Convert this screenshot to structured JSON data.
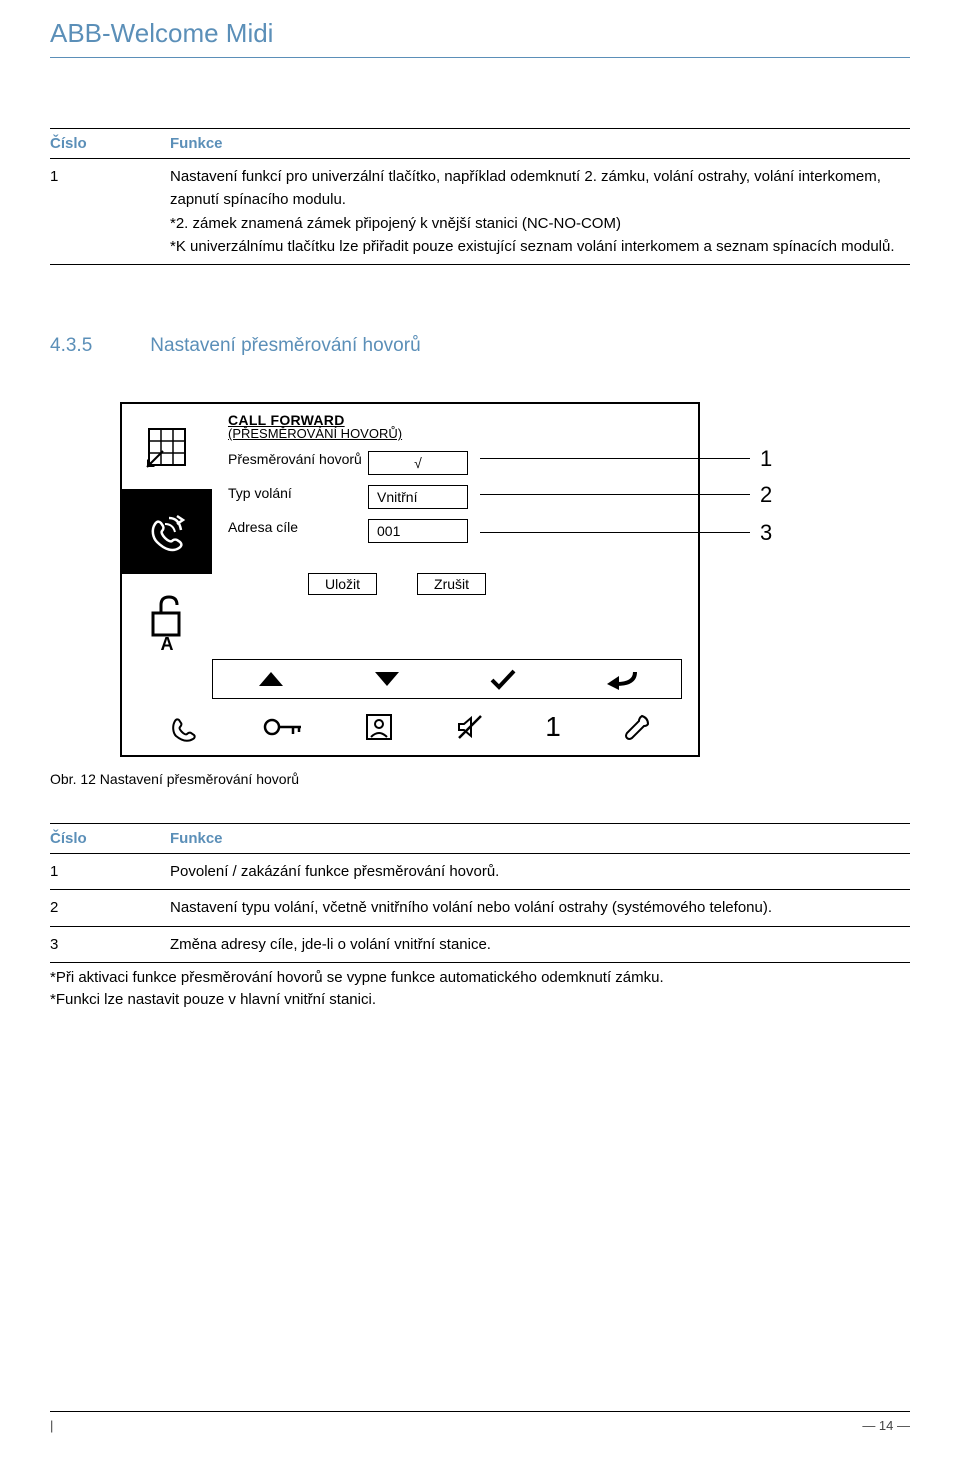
{
  "header": {
    "title": "ABB-Welcome Midi"
  },
  "table1": {
    "head_num": "Číslo",
    "head_func": "Funkce",
    "rows": [
      {
        "n": "1",
        "t": "Nastavení funkcí pro univerzální tlačítko, například odemknutí 2. zámku, volání ostrahy, volání interkomem, zapnutí spínacího modulu.\n*2. zámek znamená zámek připojený k vnější stanici (NC-NO-COM)\n*K univerzálnímu tlačítku lze přiřadit pouze existující seznam volání interkomem a seznam spínacích modulů."
      }
    ]
  },
  "section": {
    "num": "4.3.5",
    "title": "Nastavení přesměrování hovorů"
  },
  "screen": {
    "title": "CALL FORWARD",
    "subtitle": "(PŘESMĚROVÁNÍ HOVORŮ)",
    "row1_label": "Přesměrování hovorů",
    "row1_value": "√",
    "row2_label": "Typ volání",
    "row2_value": "Vnitřní",
    "row3_label": "Adresa cíle",
    "row3_value": "001",
    "save": "Uložit",
    "cancel": "Zrušit",
    "sidebar_A": "A"
  },
  "callouts": {
    "c1": "1",
    "c2": "2",
    "c3": "3"
  },
  "iconbar_num": "1",
  "figcap": "Obr. 12   Nastavení přesměrování hovorů",
  "table2": {
    "head_num": "Číslo",
    "head_func": "Funkce",
    "rows": [
      {
        "n": "1",
        "t": "Povolení / zakázání funkce přesměrování hovorů."
      },
      {
        "n": "2",
        "t": "Nastavení typu volání, včetně vnitřního volání nebo volání ostrahy (systémového telefonu)."
      },
      {
        "n": "3",
        "t": "Změna adresy cíle, jde-li o volání vnitřní stanice."
      }
    ]
  },
  "footnote1": "*Při aktivaci funkce přesměrování hovorů se vypne funkce automatického odemknutí zámku.",
  "footnote2": "*Funkci lze nastavit pouze v hlavní vnitřní stanici.",
  "footer_page": "— 14 —"
}
